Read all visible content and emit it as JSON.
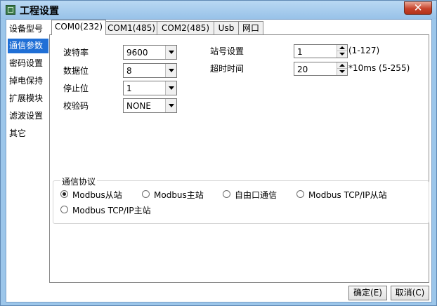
{
  "window": {
    "title": "工程设置",
    "close_symbol": "✕"
  },
  "sidebar": {
    "items": [
      {
        "label": "设备型号"
      },
      {
        "label": "通信参数"
      },
      {
        "label": "密码设置"
      },
      {
        "label": "掉电保持"
      },
      {
        "label": "扩展模块"
      },
      {
        "label": "滤波设置"
      },
      {
        "label": "其它"
      }
    ],
    "selected_index": 1
  },
  "tabs": [
    {
      "label": "COM0(232)"
    },
    {
      "label": "COM1(485)"
    },
    {
      "label": "COM2(485)"
    },
    {
      "label": "Usb"
    },
    {
      "label": "网口"
    }
  ],
  "form": {
    "baud": {
      "label": "波特率",
      "value": "9600"
    },
    "databits": {
      "label": "数据位",
      "value": "8"
    },
    "stopbits": {
      "label": "停止位",
      "value": "1"
    },
    "parity": {
      "label": "校验码",
      "value": "NONE"
    },
    "station": {
      "label": "站号设置",
      "value": "1",
      "hint": "(1-127)"
    },
    "timeout": {
      "label": "超时时间",
      "value": "20",
      "hint": "*10ms (5-255)"
    }
  },
  "protocol": {
    "title": "通信协议",
    "options": [
      {
        "label": "Modbus从站"
      },
      {
        "label": "Modbus主站"
      },
      {
        "label": "自由口通信"
      },
      {
        "label": "Modbus TCP/IP从站"
      },
      {
        "label": "Modbus TCP/IP主站"
      }
    ],
    "selected_index": 0
  },
  "buttons": {
    "ok": "确定(E)",
    "cancel": "取消(C)"
  }
}
